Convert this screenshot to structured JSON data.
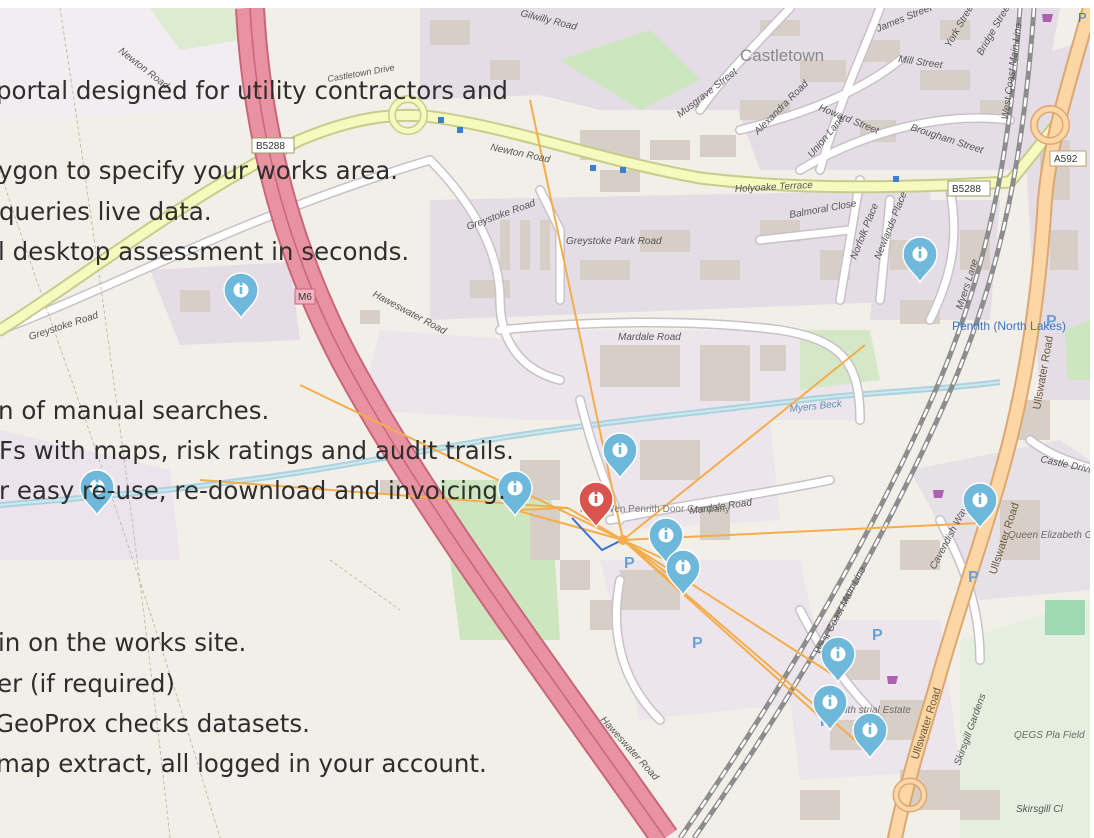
{
  "overlay_lines": [
    "portal designed for utility contractors and",
    "ygon to  specify your works area.",
    "queries live data.",
    "l desktop assessment in seconds.",
    "n of manual searches.",
    "Fs with maps, risk ratings and audit trails.",
    "r easy re-use, re-download and invoicing.",
    "in on the works site.",
    "er (if required)",
    "GeoProx checks datasets.",
    "map extract, all logged in your account."
  ],
  "map": {
    "place_labels": {
      "castletown": "Castletown",
      "penrith_north_lakes": "Penrith (North Lakes)",
      "penrith_door_company": "Field-Wen Penrith Door Company",
      "queen_elizabeth_school": "Queen Elizabeth Grammar School Penrith",
      "qegs_field": "QEGS Pla Field",
      "industrial_estate": "uth strial Estate"
    },
    "road_labels": {
      "newton_road": "Newton Road",
      "newton_road_2": "Newton Road",
      "b5288_west": "B5288",
      "b5288_east": "B5288",
      "m6": "M6",
      "a592": "A592",
      "holyoake_terrace": "Holyoake Terrace",
      "greystoke_road_w": "Greystoke Road",
      "greystoke_road_n": "Greystoke Road",
      "greystoke_park_road": "Greystoke Park Road",
      "haweswater_road_n": "Haweswater Road",
      "haweswater_road_s": "Haweswater Road",
      "mardale_road_n": "Mardale Road",
      "mardale_road_s": "Mardale Road",
      "myers_beck": "Myers Beck",
      "gilwilly_road": "Gilwilly Road",
      "castletown_drive": "Castletown Drive",
      "musgrave_street": "Musgrave Street",
      "alexandra_road": "Alexandra Road",
      "howard_street": "Howard Street",
      "union_lane": "Union Lane",
      "brougham_street": "Brougham Street",
      "mill_street": "Mill Street",
      "james_street": "James Street",
      "york_street": "York Street",
      "bridge_street": "Bridge Street",
      "balmoral_close": "Balmoral Close",
      "norfolk_place": "Norfolk Place",
      "newlands_place": "Newlands Place",
      "myers_lane": "Myers Lane",
      "ullswater_road_1": "Ullswater Road",
      "ullswater_road_2": "Ullswater Road",
      "ullswater_road_3": "Ullswater Road",
      "castle_drive": "Castle Drive",
      "cavendish_way": "Cavendish Way",
      "skirsgill_gardens": "Skirsgill Gardens",
      "skirsgill_close": "Skirsgill Cl",
      "west_coast_main_line": "West Coast Main Line",
      "west_coast_main_line_n": "West Coast Main Line"
    },
    "markers": {
      "pin_1": "i",
      "pin_2": "i",
      "pin_3": "i",
      "pin_4": "i",
      "pin_5": "i",
      "pin_6": "i",
      "pin_7": "i",
      "pin_8": "i",
      "pin_9": "i",
      "pin_10": "i",
      "pin_11": "i",
      "site_pin": "i"
    },
    "parking_symbol": "P",
    "colors": {
      "base": "#f2efe9",
      "residential": "#e4dde5",
      "industrial": "#ece5ec",
      "park": "#cde6c0",
      "motorway": "#e892a2",
      "motorway_edge": "#c9667a",
      "primary_road": "#fcd6a4",
      "primary_edge": "#dba873",
      "secondary_road": "#f7fabf",
      "secondary_edge": "#c8cc8a",
      "minor_road": "#ffffff",
      "building": "#d7cfc7",
      "water": "#aad3df",
      "railway": "#8d8d8d",
      "connector_line": "#f5ad4b",
      "info_marker": "#6db8db",
      "site_marker": "#d9534f",
      "works_polygon": "#3b6fd8",
      "overlay_text": "#2e2e2e"
    }
  }
}
